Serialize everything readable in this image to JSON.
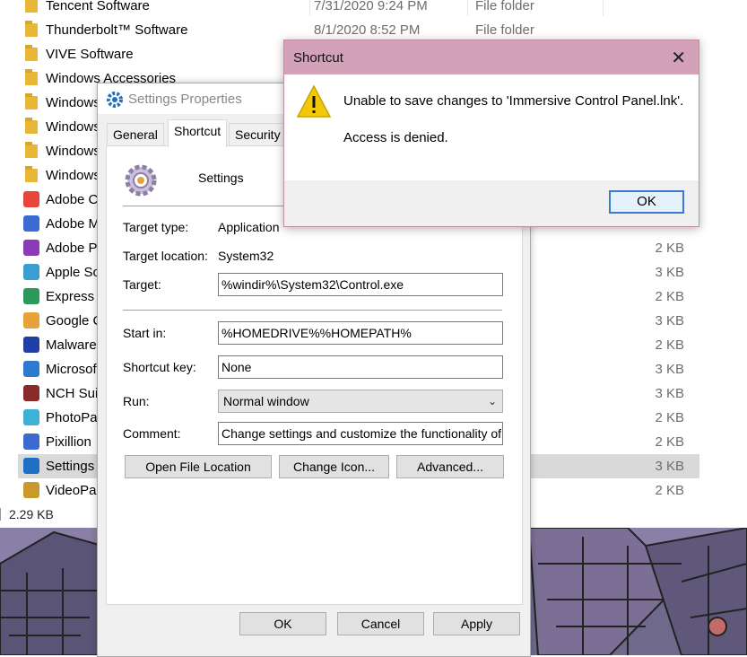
{
  "explorer": {
    "rows": [
      {
        "name": "Tencent Software",
        "date": "7/31/2020 9:24 PM",
        "type": "File folder",
        "size": ""
      },
      {
        "name": "Thunderbolt™ Software",
        "date": "8/1/2020 8:52 PM",
        "type": "File folder",
        "size": ""
      },
      {
        "name": "VIVE Software",
        "date": "",
        "type": "",
        "size": ""
      },
      {
        "name": "Windows Accessories",
        "date": "",
        "type": "",
        "size": ""
      },
      {
        "name": "Windows",
        "date": "",
        "type": "",
        "size": ""
      },
      {
        "name": "Windows",
        "date": "",
        "type": "",
        "size": ""
      },
      {
        "name": "Windows",
        "date": "",
        "type": "",
        "size": ""
      },
      {
        "name": "Windows",
        "date": "",
        "type": "",
        "size": ""
      },
      {
        "name": "Adobe C",
        "date": "",
        "type": "",
        "size": ""
      },
      {
        "name": "Adobe M",
        "date": "",
        "type": "",
        "size": ""
      },
      {
        "name": "Adobe P",
        "date": "",
        "type": "",
        "size": "2 KB"
      },
      {
        "name": "Apple So",
        "date": "",
        "type": "",
        "size": "3 KB"
      },
      {
        "name": "Express Z",
        "date": "",
        "type": "",
        "size": "2 KB"
      },
      {
        "name": "Google C",
        "date": "",
        "type": "",
        "size": "3 KB"
      },
      {
        "name": "Malware",
        "date": "",
        "type": "",
        "size": "2 KB"
      },
      {
        "name": "Microsof",
        "date": "",
        "type": "",
        "size": "3 KB"
      },
      {
        "name": "NCH Sui",
        "date": "",
        "type": "",
        "size": "3 KB"
      },
      {
        "name": "PhotoPa",
        "date": "",
        "type": "",
        "size": "2 KB"
      },
      {
        "name": "Pixillion",
        "date": "",
        "type": "",
        "size": "2 KB"
      },
      {
        "name": "Settings",
        "date": "",
        "type": "",
        "size": "3 KB"
      },
      {
        "name": "VideoPa",
        "date": "",
        "type": "",
        "size": "2 KB"
      }
    ],
    "status_size": "2.29 KB"
  },
  "props": {
    "title": "Settings Properties",
    "tabs": {
      "general": "General",
      "shortcut": "Shortcut",
      "security": "Security"
    },
    "name": "Settings",
    "target_type_label": "Target type:",
    "target_type": "Application",
    "target_location_label": "Target location:",
    "target_location": "System32",
    "target_label": "Target:",
    "target": "%windir%\\System32\\Control.exe",
    "start_in_label": "Start in:",
    "start_in": "%HOMEDRIVE%%HOMEPATH%",
    "shortcut_key_label": "Shortcut key:",
    "shortcut_key": "None",
    "run_label": "Run:",
    "run": "Normal window",
    "comment_label": "Comment:",
    "comment": "Change settings and customize the functionality of you",
    "buttons": {
      "open_location": "Open File Location",
      "change_icon": "Change Icon...",
      "advanced": "Advanced...",
      "ok": "OK",
      "cancel": "Cancel",
      "apply": "Apply"
    }
  },
  "error": {
    "title": "Shortcut",
    "message": "Unable to save changes to 'Immersive Control Panel.lnk'.",
    "detail": "Access is denied.",
    "ok": "OK"
  },
  "colors": {
    "error_titlebar": "#d3a1b8",
    "selected_row": "#d9d9d9",
    "warning": "#f3c80b"
  }
}
